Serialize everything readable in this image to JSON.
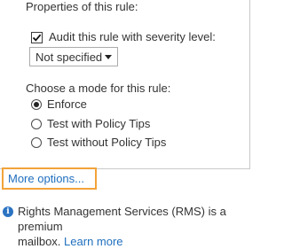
{
  "rule": {
    "heading": "Properties of this rule:",
    "audit_checked": true,
    "audit_label": "Audit this rule with severity level:",
    "severity_value": "Not specified"
  },
  "mode": {
    "label": "Choose a mode for this rule:",
    "options": [
      {
        "label": "Enforce",
        "selected": true
      },
      {
        "label": "Test with Policy Tips",
        "selected": false
      },
      {
        "label": "Test without Policy Tips",
        "selected": false
      }
    ]
  },
  "links": {
    "more_options": "More options..."
  },
  "info": {
    "icon": "info-icon",
    "line1": "Rights Management Services (RMS) is a premium",
    "line2_prefix": "mailbox.",
    "learn_more": "Learn more"
  },
  "colors": {
    "link": "#1f6fbe",
    "highlight_border": "#f2a33a",
    "info_icon": "#2b73c2"
  }
}
